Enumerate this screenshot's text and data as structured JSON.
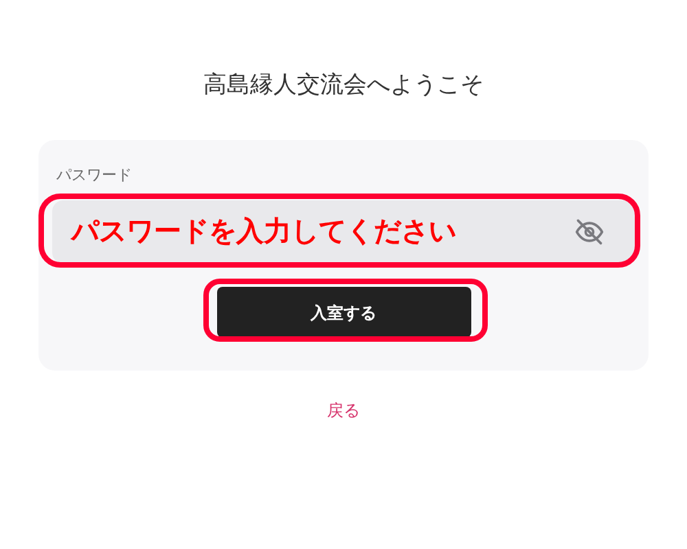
{
  "title": "高島縁人交流会へようこそ",
  "form": {
    "password_label": "パスワード",
    "password_visible": false,
    "submit": "入室する"
  },
  "back_link": "戻る",
  "field_annotation": {
    "text": "パスワードを入力してください"
  },
  "button_annotated": true
}
